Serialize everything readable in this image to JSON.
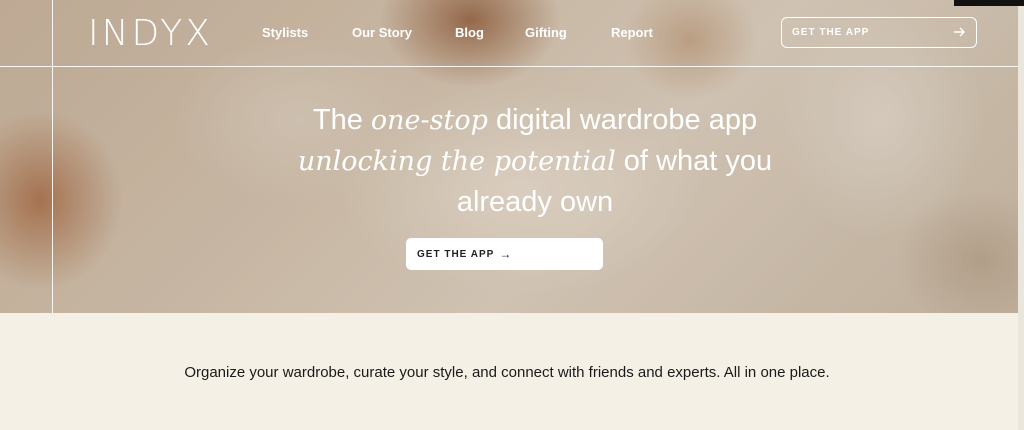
{
  "header": {
    "logo": "INDYX",
    "nav": [
      "Stylists",
      "Our Story",
      "Blog",
      "Gifting",
      "Report"
    ],
    "cta_label": "GET THE APP",
    "cta_icon": "arrow-right-icon"
  },
  "hero": {
    "line1_pre": "The ",
    "line1_em": "one-stop",
    "line1_post": " digital wardrobe app",
    "line2_em": "unlocking the potential",
    "line2_post": " of what you",
    "line3": "already own",
    "cta_label": "GET THE APP",
    "cta_arrow": "→"
  },
  "intro": {
    "text": "Organize your wardrobe, curate your style, and connect with friends and experts. All in one place."
  },
  "colors": {
    "background": "#f5f0e6",
    "text": "#1a1a1a",
    "hero_text": "#ffffff"
  }
}
